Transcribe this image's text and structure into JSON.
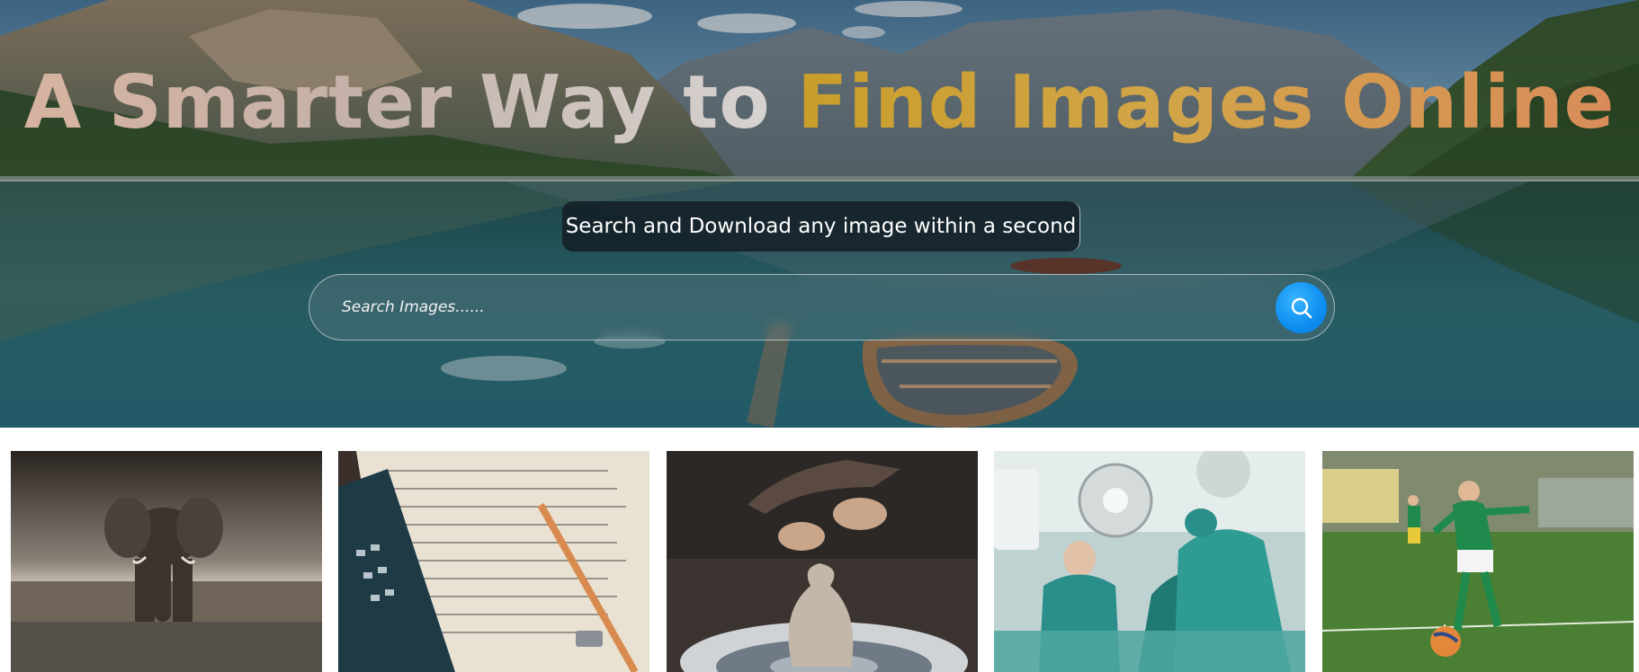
{
  "hero": {
    "title_part1": "A Smarter Way to ",
    "title_part2": "Find Images Online",
    "tagline": "Search and Download any image within a second"
  },
  "search": {
    "placeholder": "Search Images......",
    "value": "",
    "button_icon": "search-icon",
    "button_color": "#0d8ef0"
  },
  "gallery": {
    "images": [
      {
        "subject": "elephant"
      },
      {
        "subject": "math-notes-calculator"
      },
      {
        "subject": "pottery-wheel"
      },
      {
        "subject": "surgeons-operating-room"
      },
      {
        "subject": "boy-kicking-football"
      }
    ]
  }
}
